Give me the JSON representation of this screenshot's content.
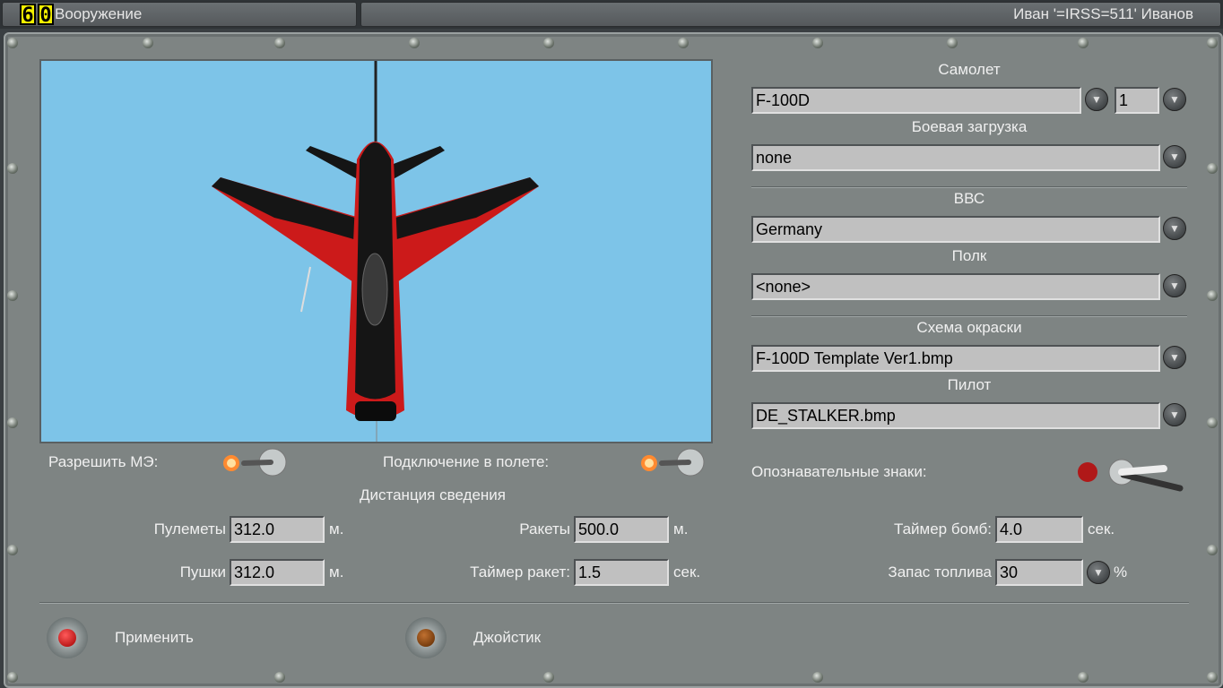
{
  "header": {
    "title": "Вооружение",
    "user": "Иван '=IRSS=511' Иванов",
    "fps": "60"
  },
  "aircraft": {
    "label": "Самолет",
    "value": "F-100D",
    "count": "1"
  },
  "loadout": {
    "label": "Боевая загрузка",
    "value": "none"
  },
  "air_force": {
    "label": "ВВС",
    "value": "Germany"
  },
  "regiment": {
    "label": "Полк",
    "value": "<none>"
  },
  "skin": {
    "label": "Схема окраски",
    "value": "F-100D Template Ver1.bmp"
  },
  "pilot": {
    "label": "Пилот",
    "value": "DE_STALKER.bmp"
  },
  "markings": {
    "label": "Опознавательные знаки:"
  },
  "toggles": {
    "allow_me": "Разрешить МЭ:",
    "inflight": "Подключение в полете:"
  },
  "convergence": {
    "title": "Дистанция сведения",
    "mg_label": "Пулеметы",
    "mg_value": "312.0",
    "mg_unit": "м.",
    "cannon_label": "Пушки",
    "cannon_value": "312.0",
    "cannon_unit": "м.",
    "rockets_label": "Ракеты",
    "rockets_value": "500.0",
    "rockets_unit": "м.",
    "rocket_timer_label": "Таймер ракет:",
    "rocket_timer_value": "1.5",
    "rocket_timer_unit": "сек.",
    "bomb_timer_label": "Таймер бомб:",
    "bomb_timer_value": "4.0",
    "bomb_timer_unit": "сек.",
    "fuel_label": "Запас топлива",
    "fuel_value": "30",
    "fuel_unit": "%"
  },
  "buttons": {
    "apply": "Применить",
    "joystick": "Джойстик"
  }
}
